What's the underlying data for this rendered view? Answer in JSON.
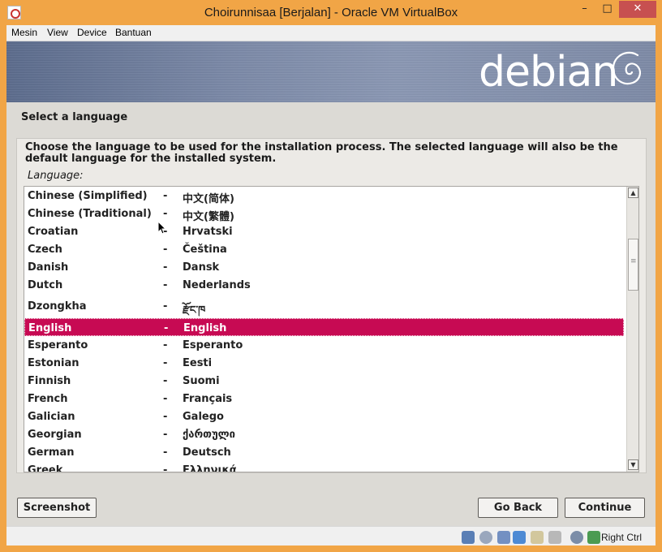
{
  "window": {
    "title": "Choirunnisaa [Berjalan] - Oracle VM VirtualBox",
    "controls": [
      "minimize-icon",
      "maximize-icon",
      "close-icon"
    ]
  },
  "menu": [
    "Mesin",
    "View",
    "Device",
    "Bantuan"
  ],
  "banner": {
    "logo_text": "debian"
  },
  "installer": {
    "step_title": "Select a language",
    "description": "Choose the language to be used for the installation process. The selected language will also be the default language for the installed system.",
    "list_label": "Language:",
    "languages": [
      {
        "name": "Chinese (Simplified)",
        "sep": "-",
        "native": "中文(简体)"
      },
      {
        "name": "Chinese (Traditional)",
        "sep": "-",
        "native": "中文(繁體)"
      },
      {
        "name": "Croatian",
        "sep": "-",
        "native": "Hrvatski"
      },
      {
        "name": "Czech",
        "sep": "-",
        "native": "Čeština"
      },
      {
        "name": "Danish",
        "sep": "-",
        "native": "Dansk"
      },
      {
        "name": "Dutch",
        "sep": "-",
        "native": "Nederlands"
      },
      {
        "name": "Dzongkha",
        "sep": "-",
        "native": "རྫོང་ཁ"
      },
      {
        "name": "English",
        "sep": "-",
        "native": "English",
        "selected": true
      },
      {
        "name": "Esperanto",
        "sep": "-",
        "native": "Esperanto"
      },
      {
        "name": "Estonian",
        "sep": "-",
        "native": "Eesti"
      },
      {
        "name": "Finnish",
        "sep": "-",
        "native": "Suomi"
      },
      {
        "name": "French",
        "sep": "-",
        "native": "Français"
      },
      {
        "name": "Galician",
        "sep": "-",
        "native": "Galego"
      },
      {
        "name": "Georgian",
        "sep": "-",
        "native": "ქართული"
      },
      {
        "name": "German",
        "sep": "-",
        "native": "Deutsch"
      },
      {
        "name": "Greek",
        "sep": "-",
        "native": "Ελληνικά"
      }
    ],
    "buttons": {
      "screenshot": "Screenshot",
      "go_back": "Go Back",
      "continue": "Continue"
    }
  },
  "statusbar": {
    "icons": [
      "hard-disk-icon",
      "optical-drive-icon",
      "usb-icon",
      "network-icon",
      "shared-folder-icon",
      "display-icon",
      "video-capture-icon",
      "mouse-integration-icon",
      "keyboard-icon"
    ],
    "host_key": "Right Ctrl"
  },
  "colors": {
    "frame": "#f1a546",
    "selection": "#c70a53",
    "close_button": "#c75050"
  }
}
